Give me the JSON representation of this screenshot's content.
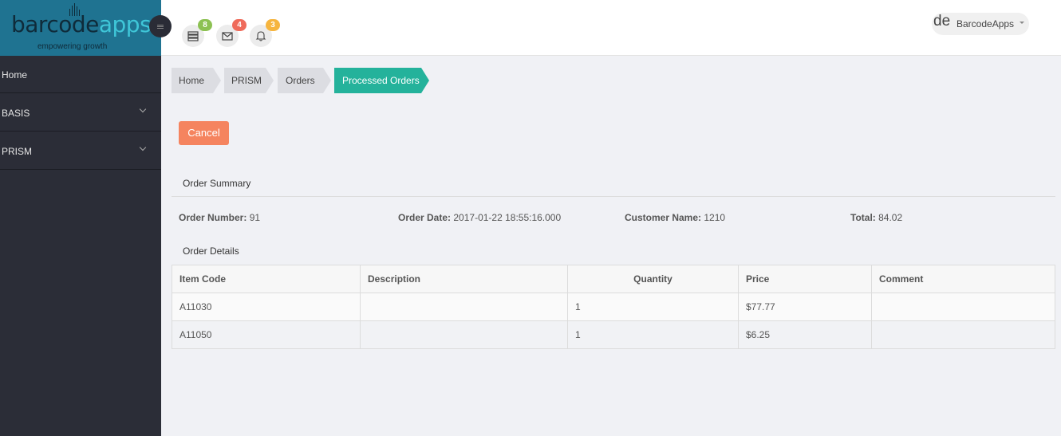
{
  "brand": {
    "name_part1": "barcode",
    "name_part2": "apps",
    "tagline": "empowering growth"
  },
  "header": {
    "notifications": [
      {
        "icon": "server-icon",
        "count": "8",
        "color": "#8cc152"
      },
      {
        "icon": "envelope-icon",
        "count": "4",
        "color": "#ef6b5b"
      },
      {
        "icon": "bell-icon",
        "count": "3",
        "color": "#f6b53f"
      }
    ],
    "user": {
      "fragment": "de",
      "name": "BarcodeApps"
    }
  },
  "sidebar": {
    "items": [
      {
        "label": "Home"
      },
      {
        "label": "BASIS"
      },
      {
        "label": "PRISM"
      }
    ]
  },
  "breadcrumb": [
    "Home",
    "PRISM",
    "Orders",
    "Processed Orders"
  ],
  "actions": {
    "cancel_label": "Cancel"
  },
  "order_summary": {
    "title": "Order Summary",
    "order_number_label": "Order Number:",
    "order_number": "91",
    "order_date_label": "Order Date:",
    "order_date": "2017-01-22 18:55:16.000",
    "customer_name_label": "Customer Name:",
    "customer_name": "1210",
    "total_label": "Total:",
    "total": "84.02"
  },
  "order_details": {
    "title": "Order Details",
    "columns": [
      "Item Code",
      "Description",
      "Quantity",
      "Price",
      "Comment"
    ],
    "rows": [
      {
        "item_code": "A11030",
        "description": "",
        "quantity": "1",
        "price": "$77.77",
        "comment": ""
      },
      {
        "item_code": "A11050",
        "description": "",
        "quantity": "1",
        "price": "$6.25",
        "comment": ""
      }
    ]
  },
  "colors": {
    "brand_bg": "#1f7391",
    "sidebar_bg": "#2b2d37",
    "accent": "#24b29b",
    "cancel": "#f5845f"
  }
}
